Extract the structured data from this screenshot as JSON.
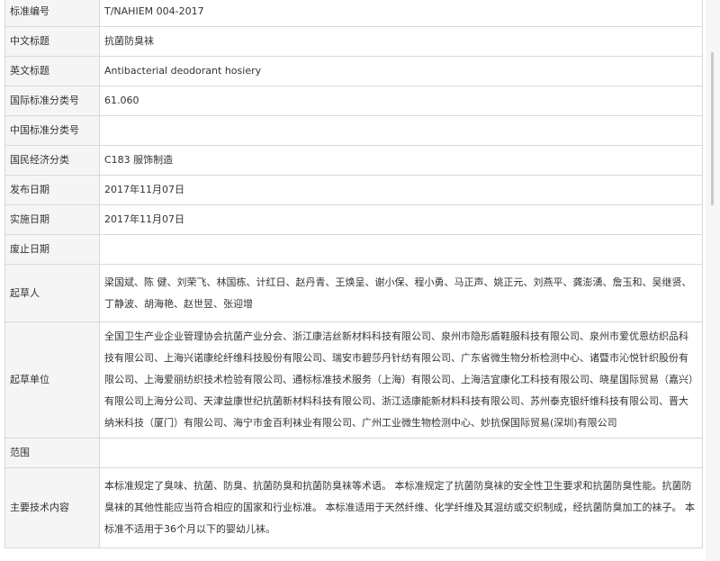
{
  "rows": [
    {
      "label": "标准编号",
      "value": "T/NAHIEM 004-2017"
    },
    {
      "label": "中文标题",
      "value": "抗菌防臭袜"
    },
    {
      "label": "英文标题",
      "value": "Antibacterial deodorant hosiery"
    },
    {
      "label": "国际标准分类号",
      "value": "61.060"
    },
    {
      "label": "中国标准分类号",
      "value": ""
    },
    {
      "label": "国民经济分类",
      "value": "C183 服饰制造"
    },
    {
      "label": "发布日期",
      "value": "2017年11月07日"
    },
    {
      "label": "实施日期",
      "value": "2017年11月07日"
    },
    {
      "label": "废止日期",
      "value": ""
    },
    {
      "label": "起草人",
      "value": "梁国斌、陈 健、刘荣飞、林国栋、计红日、赵丹青、王焕呈、谢小保、程小勇、马正声、姚正元、刘燕平、龚澎湧、詹玉和、吴继贤、丁静波、胡海艳、赵世昱、张迎增"
    },
    {
      "label": "起草单位",
      "value": "全国卫生产业企业管理协会抗菌产业分会、浙江康洁丝新材料科技有限公司、泉州市隐形盾鞋服科技有限公司、泉州市爱优恩纺织品科技有限公司、上海兴诺康纶纤维科技股份有限公司、瑞安市碧莎丹针纺有限公司、广东省微生物分析检测中心、诸暨市沁悦针织股份有限公司、上海爱丽纺织技术检验有限公司、通标标准技术服务（上海）有限公司、上海洁宜康化工科技有限公司、晓星国际贸易（嘉兴）有限公司上海分公司、天津益康世纪抗菌新材料科技有限公司、浙江适康能新材料科技有限公司、苏州泰克银纤维科技有限公司、晋大纳米科技（厦门）有限公司、海宁市金百利袜业有限公司、广州工业微生物检测中心、妙抗保国际贸易(深圳)有限公司"
    },
    {
      "label": "范围",
      "value": ""
    },
    {
      "label": "主要技术内容",
      "value": "本标准规定了臭味、抗菌、防臭、抗菌防臭和抗菌防臭袜等术语。 本标准规定了抗菌防臭袜的安全性卫生要求和抗菌防臭性能。抗菌防臭袜的其他性能应当符合相应的国家和行业标准。 本标准适用于天然纤维、化学纤维及其混纺或交织制成，经抗菌防臭加工的袜子。 本标准不适用于36个月以下的婴幼儿袜。"
    }
  ]
}
